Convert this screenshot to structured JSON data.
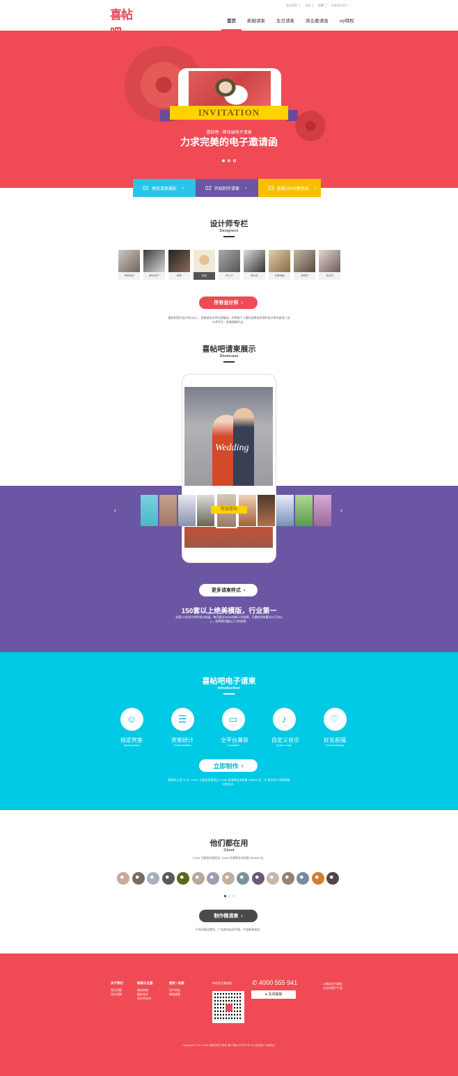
{
  "header": {
    "logo": "喜帖吧",
    "toplinks": [
      "会员登录",
      "注册",
      "收藏",
      "社会化分享 ▾"
    ],
    "nav": [
      "首页",
      "新婚请柬",
      "生日请柬",
      "商业邀请函",
      "vip特权"
    ]
  },
  "hero": {
    "ribbon": "INVITATION",
    "subtitle": "喜帖吧 - 移动端电子请柬",
    "title": "力求完美的电子邀请函"
  },
  "steps": [
    {
      "num": "01",
      "label": "预览请柬摄影",
      "color": "#2bc4e8"
    },
    {
      "num": "02",
      "label": "开始制作请柬",
      "color": "#6b56a3"
    },
    {
      "num": "03",
      "label": "查看VIP付费特权",
      "color": "#f6c000"
    }
  ],
  "designers": {
    "title": "设计师专栏",
    "subtitle": "Designers",
    "items": [
      "琴瑟依依",
      "静待花开",
      "柳林",
      "执念",
      "风之子",
      "爱永恒",
      "长路相随",
      "我愿意",
      "告白范"
    ],
    "button": "所有设计师",
    "desc": "喜帖吧签约设计师158人，现邀请设计师为您精选，并将按个人喜好选择适合您的设计师作者进入设计师专栏，查看精美作品。"
  },
  "showcase": {
    "title": "喜帖吧请柬展示",
    "subtitle": "Showcase",
    "screen_text": "Wedding",
    "thumb_label": "新婚喜帖",
    "button": "更多请柬样式",
    "headline": "150套以上绝美模版，行业第一",
    "desc": "全国112名设计师的设计结晶，每天超过30000对新人的选择，日量帖浏览量达10万次以上，选择我们最自己二的选择。"
  },
  "intro": {
    "title": "喜帖吧电子请柬",
    "subtitle": "Introduction",
    "features": [
      {
        "icon": "guests-icon",
        "glyph": "☺",
        "title": "指定宾客",
        "en": "Specify guests"
      },
      {
        "icon": "list-icon",
        "glyph": "☰",
        "title": "宾客统计",
        "en": "Guests statistics"
      },
      {
        "icon": "devices-icon",
        "glyph": "▭",
        "title": "全平台兼容",
        "en": "Compatible"
      },
      {
        "icon": "music-icon",
        "glyph": "♪",
        "title": "自定义音乐",
        "en": "Custom music"
      },
      {
        "icon": "hearts-icon",
        "glyph": "♡",
        "title": "好友祝福",
        "en": "Friends blessing"
      }
    ],
    "button": "立即制作",
    "desc": "喜帖吧上线 76 天, 12161 注册会员使用过 11484 份请柬总浏览量 492840 次。30 家合作公司和电脑分发设计。"
  },
  "clients": {
    "title": "他们都在用",
    "subtitle": "Client",
    "stats": "12161 注册会员使用过 11484 份请柬总浏览量 492840 次。",
    "button": "制作微请柬",
    "desc": "不含印刷品费用，广告商包括但不限，不会影响体验。",
    "colors": [
      "#c8a9a0",
      "#7a6a62",
      "#a8b0c0",
      "#5a5a5a",
      "#5a6a1a",
      "#b8a898",
      "#9aa0b0",
      "#c0b0a0",
      "#8090a0",
      "#6a5a7a",
      "#c8b8a8",
      "#9a8070",
      "#7a8aa0",
      "#d08030",
      "#504848"
    ]
  },
  "footer": {
    "cols": [
      {
        "title": "关于我们",
        "items": [
          "常见问题",
          "设计问题"
        ]
      },
      {
        "title": "联络与支援",
        "items": [
          "服务热线",
          "服务合作",
          "设计师合作"
        ]
      },
      {
        "title": "授权 / 条款",
        "items": [
          "用户协议",
          "隐私政策"
        ]
      }
    ],
    "qr_title": "你你关注喜帖吧",
    "phone": "4000 555 941",
    "online": "在线客服",
    "mobile": "▸ 移动电子请帖",
    "mobile_sub": "点击扫描下产品",
    "copyright": "Copyright © 2014 Xieticr 喜帖吧电子请柬 漏ICP备11093557号-16 | 站站统计 流量统计"
  },
  "colors": {
    "accent": "#f04b55",
    "purple": "#6b56a3",
    "cyan": "#00c9e5",
    "yellow": "#ffd200"
  }
}
